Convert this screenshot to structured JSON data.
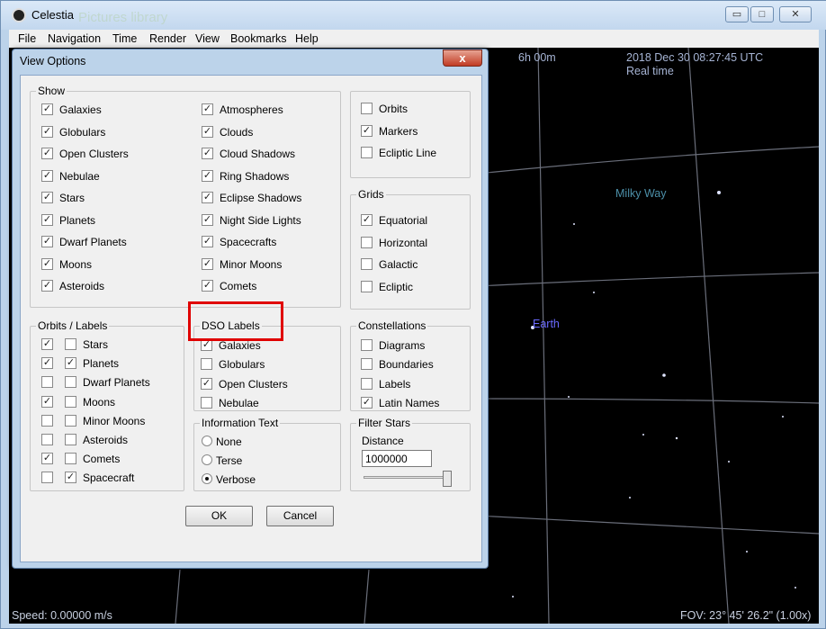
{
  "window": {
    "title": "Celestia",
    "ghost_title": "Pictures library"
  },
  "window_controls": {
    "minimize": "▭",
    "maximize": "□",
    "close": "✕"
  },
  "menu": [
    "File",
    "Navigation",
    "Time",
    "Render",
    "View",
    "Bookmarks",
    "Help"
  ],
  "sky": {
    "ra_label": "6h 00m",
    "date": "2018 Dec 30 08:27:45 UTC",
    "time_mode": "Real time",
    "milky_way": "Milky Way",
    "earth": "Earth",
    "speed": "Speed: 0.00000 m/s",
    "fov": "FOV: 23° 45' 26.2\" (1.00x)"
  },
  "dialog": {
    "title": "View Options",
    "close_label": "x",
    "show": {
      "title": "Show",
      "col1": [
        {
          "label": "Galaxies",
          "checked": true
        },
        {
          "label": "Globulars",
          "checked": true
        },
        {
          "label": "Open Clusters",
          "checked": true
        },
        {
          "label": "Nebulae",
          "checked": true
        },
        {
          "label": "Stars",
          "checked": true
        },
        {
          "label": "Planets",
          "checked": true
        },
        {
          "label": "Dwarf Planets",
          "checked": true
        },
        {
          "label": "Moons",
          "checked": true
        },
        {
          "label": "Asteroids",
          "checked": true
        }
      ],
      "col2": [
        {
          "label": "Atmospheres",
          "checked": true
        },
        {
          "label": "Clouds",
          "checked": true
        },
        {
          "label": "Cloud Shadows",
          "checked": true
        },
        {
          "label": "Ring Shadows",
          "checked": true
        },
        {
          "label": "Eclipse Shadows",
          "checked": true
        },
        {
          "label": "Night Side Lights",
          "checked": true
        },
        {
          "label": "Spacecrafts",
          "checked": true
        },
        {
          "label": "Minor Moons",
          "checked": true
        },
        {
          "label": "Comets",
          "checked": true
        }
      ]
    },
    "misc": [
      {
        "label": "Orbits",
        "checked": false
      },
      {
        "label": "Markers",
        "checked": true
      },
      {
        "label": "Ecliptic Line",
        "checked": false
      }
    ],
    "grids": {
      "title": "Grids",
      "items": [
        {
          "label": "Equatorial",
          "checked": true
        },
        {
          "label": "Horizontal",
          "checked": false
        },
        {
          "label": "Galactic",
          "checked": false
        },
        {
          "label": "Ecliptic",
          "checked": false
        }
      ]
    },
    "orbits_labels": {
      "title": "Orbits / Labels",
      "items": [
        {
          "label": "Stars",
          "orbit": true,
          "label_on": false
        },
        {
          "label": "Planets",
          "orbit": true,
          "label_on": true
        },
        {
          "label": "Dwarf Planets",
          "orbit": false,
          "label_on": false
        },
        {
          "label": "Moons",
          "orbit": true,
          "label_on": false
        },
        {
          "label": "Minor Moons",
          "orbit": false,
          "label_on": false
        },
        {
          "label": "Asteroids",
          "orbit": false,
          "label_on": false
        },
        {
          "label": "Comets",
          "orbit": true,
          "label_on": false
        },
        {
          "label": "Spacecraft",
          "orbit": false,
          "label_on": true
        }
      ]
    },
    "dso_labels": {
      "title": "DSO Labels",
      "items": [
        {
          "label": "Galaxies",
          "checked": true
        },
        {
          "label": "Globulars",
          "checked": false
        },
        {
          "label": "Open Clusters",
          "checked": true
        },
        {
          "label": "Nebulae",
          "checked": false
        }
      ]
    },
    "constellations": {
      "title": "Constellations",
      "items": [
        {
          "label": "Diagrams",
          "checked": false
        },
        {
          "label": "Boundaries",
          "checked": false
        },
        {
          "label": "Labels",
          "checked": false
        },
        {
          "label": "Latin Names",
          "checked": true
        }
      ]
    },
    "info_text": {
      "title": "Information Text",
      "options": [
        {
          "label": "None",
          "selected": false
        },
        {
          "label": "Terse",
          "selected": false
        },
        {
          "label": "Verbose",
          "selected": true
        }
      ]
    },
    "filter_stars": {
      "title": "Filter Stars",
      "distance_label": "Distance",
      "distance_value": "1000000",
      "slider_position": 0.97
    },
    "ok_label": "OK",
    "cancel_label": "Cancel"
  }
}
